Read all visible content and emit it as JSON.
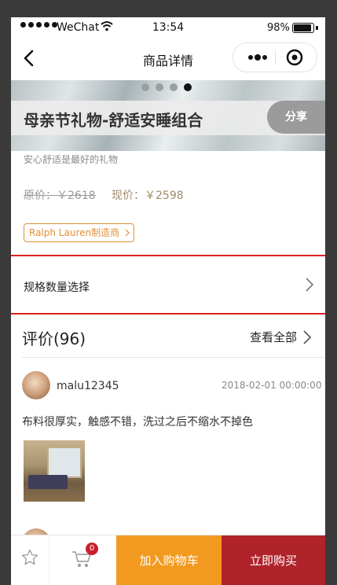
{
  "status_bar": {
    "carrier": "WeChat",
    "time": "13:54",
    "battery": "98%"
  },
  "nav": {
    "title": "商品详情"
  },
  "banner": {
    "slide_count": 4,
    "active_index": 3
  },
  "product": {
    "title": "母亲节礼物-舒适安睡组合",
    "share_label": "分享",
    "subtitle": "安心舒适是最好的礼物",
    "original_price_label": "原价：￥2618",
    "current_price_label": "现价：￥2598",
    "brand_tag": "Ralph Lauren制造商"
  },
  "spec": {
    "label": "规格数量选择"
  },
  "reviews": {
    "title": "评价(96)",
    "see_all": "查看全部",
    "items": [
      {
        "username": "malu12345",
        "date": "2018-02-01 00:00:00",
        "text": "布料很厚实，触感不错，洗过之后不缩水不掉色"
      }
    ]
  },
  "bottom_bar": {
    "cart_count": "0",
    "add_to_cart": "加入购物车",
    "buy_now": "立即购买",
    "colors": {
      "add_to_cart_bg": "#f29a20",
      "buy_now_bg": "#b0232a"
    }
  }
}
